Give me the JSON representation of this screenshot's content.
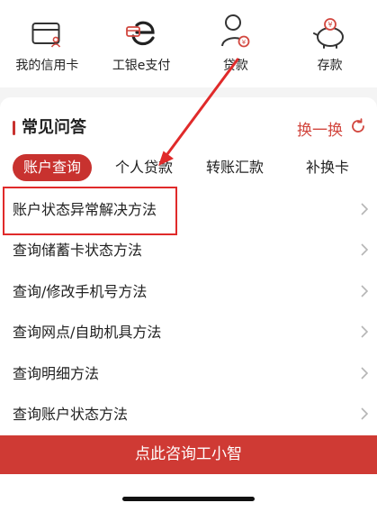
{
  "quick_actions": [
    {
      "icon": "credit-card-icon",
      "label": "我的信用卡"
    },
    {
      "icon": "e-pay-icon",
      "label": "工银e支付"
    },
    {
      "icon": "loan-person-icon",
      "label": "贷款"
    },
    {
      "icon": "piggy-bank-icon",
      "label": "存款"
    }
  ],
  "faq": {
    "title": "常见问答",
    "refresh_label": "换一换",
    "tabs": [
      "账户查询",
      "个人贷款",
      "转账汇款",
      "补换卡"
    ],
    "active_tab": "账户查询",
    "items": [
      "账户状态异常解决方法",
      "查询储蓄卡状态方法",
      "查询/修改手机号方法",
      "查询网点/自助机具方法",
      "查询明细方法",
      "查询账户状态方法"
    ]
  },
  "consult_button": "点此咨询工小智",
  "colors": {
    "brand_red": "#c8322f",
    "annotation_red": "#e02a2a"
  }
}
